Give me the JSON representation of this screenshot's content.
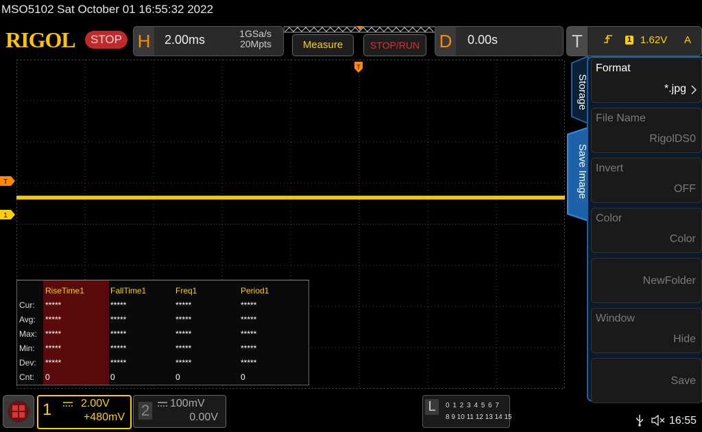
{
  "title_line": "MSO5102  Sat October 01 16:55:32 2022",
  "logo": "RIGOL",
  "run_state": "STOP",
  "horizontal": {
    "letter": "H",
    "scale": "2.00ms",
    "sample_rate": "1GSa/s",
    "memory_depth": "20Mpts"
  },
  "buttons": {
    "measure": "Measure",
    "stop_run": "STOP/RUN"
  },
  "delay": {
    "letter": "D",
    "value": "0.00s"
  },
  "trigger": {
    "letter": "T",
    "channel": "1",
    "level": "1.62V",
    "mode": "A",
    "marker": "T"
  },
  "ch1_marker": "1",
  "measurements": {
    "columns": [
      "RiseTime1",
      "FallTime1",
      "Freq1",
      "Period1"
    ],
    "rows": [
      {
        "label": "Cur:",
        "values": [
          "*****",
          "*****",
          "*****",
          "*****"
        ]
      },
      {
        "label": "Avg:",
        "values": [
          "*****",
          "*****",
          "*****",
          "*****"
        ]
      },
      {
        "label": "Max:",
        "values": [
          "*****",
          "*****",
          "*****",
          "*****"
        ]
      },
      {
        "label": "Min:",
        "values": [
          "*****",
          "*****",
          "*****",
          "*****"
        ]
      },
      {
        "label": "Dev:",
        "values": [
          "*****",
          "*****",
          "*****",
          "*****"
        ]
      },
      {
        "label": "Cnt:",
        "values": [
          "0",
          "0",
          "0",
          "0"
        ]
      }
    ]
  },
  "side_tabs": {
    "storage": "Storage",
    "save_image": "Save Image"
  },
  "side_menu": [
    {
      "title": "Format",
      "value": "*.jpg",
      "dim": false
    },
    {
      "title": "File Name",
      "value": "RigolDS0",
      "dim": true
    },
    {
      "title": "Invert",
      "value": "OFF",
      "dim": true
    },
    {
      "title": "Color",
      "value": "Color",
      "dim": true
    },
    {
      "title": "",
      "value": "NewFolder",
      "dim": true
    },
    {
      "title": "Window",
      "value": "Hide",
      "dim": true
    },
    {
      "title": "",
      "value": "Save",
      "dim": true
    }
  ],
  "channels": {
    "ch1": {
      "number": "1",
      "scale": "2.00V",
      "offset": "+480mV"
    },
    "ch2": {
      "number": "2",
      "scale": "100mV",
      "offset": "0.00V"
    }
  },
  "logic": {
    "letter": "L",
    "row1": "0 1 2 3  4 5 6 7",
    "row2": "8 9 10 11 12 13 14 15"
  },
  "clock": "16:55",
  "colors": {
    "ch1": "#ffd000",
    "accent": "#ff8a00",
    "stop": "#c02a2a",
    "panel_border": "#1d62a8"
  }
}
